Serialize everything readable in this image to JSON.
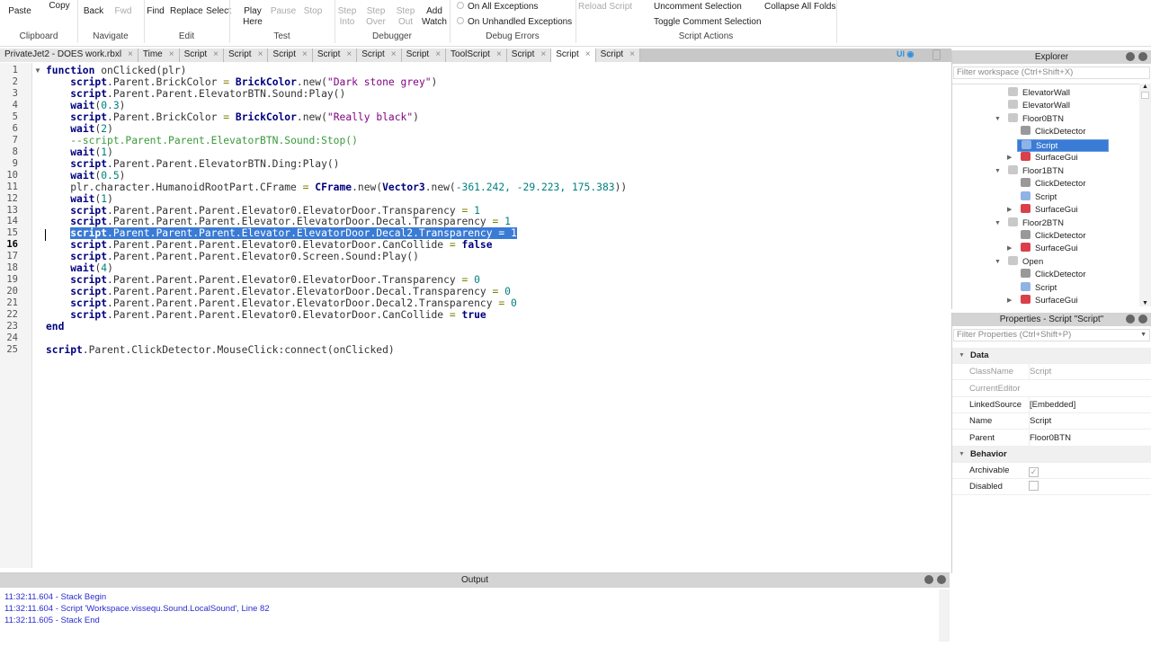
{
  "ribbon": {
    "buttons": [
      {
        "label": "Paste",
        "dis": false
      },
      {
        "label": "Copy",
        "dis": false
      },
      {
        "label": "Back",
        "dis": false
      },
      {
        "label": "Fwd",
        "dis": true
      },
      {
        "label": "Find",
        "dis": false
      },
      {
        "label": "Replace",
        "dis": false
      },
      {
        "label": "Select",
        "dis": false
      },
      {
        "label": "Play Here",
        "dis": false
      },
      {
        "label": "Pause",
        "dis": true
      },
      {
        "label": "Stop",
        "dis": true
      },
      {
        "label": "Step Into",
        "dis": true
      },
      {
        "label": "Step Over",
        "dis": true
      },
      {
        "label": "Step Out",
        "dis": true
      },
      {
        "label": "Add Watch",
        "dis": false
      }
    ],
    "groups": [
      "Clipboard",
      "Navigate",
      "Edit",
      "Test",
      "Debugger",
      "Debug Errors",
      "Script Actions"
    ],
    "debug_errors": [
      "On All Exceptions",
      "On Unhandled Exceptions"
    ],
    "reload_script": "Reload Script",
    "uncomment": "Uncomment Selection",
    "toggle_comment": "Toggle Comment Selection",
    "collapse_folds": "Collapse All Folds"
  },
  "tabs": [
    {
      "label": "PrivateJet2 - DOES work.rbxl"
    },
    {
      "label": "Time"
    },
    {
      "label": "Script"
    },
    {
      "label": "Script"
    },
    {
      "label": "Script"
    },
    {
      "label": "Script"
    },
    {
      "label": "Script"
    },
    {
      "label": "Script"
    },
    {
      "label": "ToolScript"
    },
    {
      "label": "Script"
    },
    {
      "label": "Script",
      "active": true
    },
    {
      "label": "Script"
    }
  ],
  "ui_toggle": "UI",
  "code": {
    "selected_line": 15,
    "current_line": 16,
    "lines": [
      [
        {
          "c": "kw",
          "t": "function"
        },
        {
          "c": "",
          "t": " onClicked(plr)"
        }
      ],
      [
        {
          "c": "",
          "t": "    "
        },
        {
          "c": "kw",
          "t": "script"
        },
        {
          "c": "",
          "t": ".Parent.BrickColor "
        },
        {
          "c": "op",
          "t": "="
        },
        {
          "c": "",
          "t": " "
        },
        {
          "c": "bi",
          "t": "BrickColor"
        },
        {
          "c": "",
          "t": ".new("
        },
        {
          "c": "st",
          "t": "\"Dark stone grey\""
        },
        {
          "c": "",
          "t": ")"
        }
      ],
      [
        {
          "c": "",
          "t": "    "
        },
        {
          "c": "kw",
          "t": "script"
        },
        {
          "c": "",
          "t": ".Parent.Parent.ElevatorBTN.Sound:Play()"
        }
      ],
      [
        {
          "c": "",
          "t": "    "
        },
        {
          "c": "kw",
          "t": "wait"
        },
        {
          "c": "",
          "t": "("
        },
        {
          "c": "nu",
          "t": "0.3"
        },
        {
          "c": "",
          "t": ")"
        }
      ],
      [
        {
          "c": "",
          "t": "    "
        },
        {
          "c": "kw",
          "t": "script"
        },
        {
          "c": "",
          "t": ".Parent.BrickColor "
        },
        {
          "c": "op",
          "t": "="
        },
        {
          "c": "",
          "t": " "
        },
        {
          "c": "bi",
          "t": "BrickColor"
        },
        {
          "c": "",
          "t": ".new("
        },
        {
          "c": "st",
          "t": "\"Really black\""
        },
        {
          "c": "",
          "t": ")"
        }
      ],
      [
        {
          "c": "",
          "t": "    "
        },
        {
          "c": "kw",
          "t": "wait"
        },
        {
          "c": "",
          "t": "("
        },
        {
          "c": "nu",
          "t": "2"
        },
        {
          "c": "",
          "t": ")"
        }
      ],
      [
        {
          "c": "",
          "t": "    "
        },
        {
          "c": "cm",
          "t": "--script.Parent.Parent.ElevatorBTN.Sound:Stop()"
        }
      ],
      [
        {
          "c": "",
          "t": "    "
        },
        {
          "c": "kw",
          "t": "wait"
        },
        {
          "c": "",
          "t": "("
        },
        {
          "c": "nu",
          "t": "1"
        },
        {
          "c": "",
          "t": ")"
        }
      ],
      [
        {
          "c": "",
          "t": "    "
        },
        {
          "c": "kw",
          "t": "script"
        },
        {
          "c": "",
          "t": ".Parent.Parent.ElevatorBTN.Ding:Play()"
        }
      ],
      [
        {
          "c": "",
          "t": "    "
        },
        {
          "c": "kw",
          "t": "wait"
        },
        {
          "c": "",
          "t": "("
        },
        {
          "c": "nu",
          "t": "0.5"
        },
        {
          "c": "",
          "t": ")"
        }
      ],
      [
        {
          "c": "",
          "t": "    plr.character.HumanoidRootPart.CFrame "
        },
        {
          "c": "op",
          "t": "="
        },
        {
          "c": "",
          "t": " "
        },
        {
          "c": "bi",
          "t": "CFrame"
        },
        {
          "c": "",
          "t": ".new("
        },
        {
          "c": "bi",
          "t": "Vector3"
        },
        {
          "c": "",
          "t": ".new("
        },
        {
          "c": "nu",
          "t": "-361.242, -29.223, 175.383"
        },
        {
          "c": "",
          "t": "))"
        }
      ],
      [
        {
          "c": "",
          "t": "    "
        },
        {
          "c": "kw",
          "t": "wait"
        },
        {
          "c": "",
          "t": "("
        },
        {
          "c": "nu",
          "t": "1"
        },
        {
          "c": "",
          "t": ")"
        }
      ],
      [
        {
          "c": "",
          "t": "    "
        },
        {
          "c": "kw",
          "t": "script"
        },
        {
          "c": "",
          "t": ".Parent.Parent.Parent.Elevator0.ElevatorDoor.Transparency "
        },
        {
          "c": "op",
          "t": "="
        },
        {
          "c": "nu",
          "t": " 1"
        }
      ],
      [
        {
          "c": "",
          "t": "    "
        },
        {
          "c": "kw",
          "t": "script"
        },
        {
          "c": "",
          "t": ".Parent.Parent.Parent.Elevator.ElevatorDoor.Decal.Transparency "
        },
        {
          "c": "op",
          "t": "="
        },
        {
          "c": "nu",
          "t": " 1"
        }
      ],
      [
        {
          "c": "",
          "t": "    "
        },
        {
          "c": "kw",
          "t": "script"
        },
        {
          "c": "",
          "t": ".Parent.Parent.Parent.Elevator.ElevatorDoor.Decal2.Transparency "
        },
        {
          "c": "op",
          "t": "="
        },
        {
          "c": "nu",
          "t": " 1"
        }
      ],
      [
        {
          "c": "",
          "t": "    "
        },
        {
          "c": "kw",
          "t": "script"
        },
        {
          "c": "",
          "t": ".Parent.Parent.Parent.Elevator0.ElevatorDoor.CanCollide "
        },
        {
          "c": "op",
          "t": "="
        },
        {
          "c": "",
          "t": " "
        },
        {
          "c": "kw",
          "t": "false"
        }
      ],
      [
        {
          "c": "",
          "t": "    "
        },
        {
          "c": "kw",
          "t": "script"
        },
        {
          "c": "",
          "t": ".Parent.Parent.Parent.Elevator0.Screen.Sound:Play()"
        }
      ],
      [
        {
          "c": "",
          "t": "    "
        },
        {
          "c": "kw",
          "t": "wait"
        },
        {
          "c": "",
          "t": "("
        },
        {
          "c": "nu",
          "t": "4"
        },
        {
          "c": "",
          "t": ")"
        }
      ],
      [
        {
          "c": "",
          "t": "    "
        },
        {
          "c": "kw",
          "t": "script"
        },
        {
          "c": "",
          "t": ".Parent.Parent.Parent.Elevator0.ElevatorDoor.Transparency "
        },
        {
          "c": "op",
          "t": "="
        },
        {
          "c": "nu",
          "t": " 0"
        }
      ],
      [
        {
          "c": "",
          "t": "    "
        },
        {
          "c": "kw",
          "t": "script"
        },
        {
          "c": "",
          "t": ".Parent.Parent.Parent.Elevator.ElevatorDoor.Decal.Transparency "
        },
        {
          "c": "op",
          "t": "="
        },
        {
          "c": "nu",
          "t": " 0"
        }
      ],
      [
        {
          "c": "",
          "t": "    "
        },
        {
          "c": "kw",
          "t": "script"
        },
        {
          "c": "",
          "t": ".Parent.Parent.Parent.Elevator.ElevatorDoor.Decal2.Transparency "
        },
        {
          "c": "op",
          "t": "="
        },
        {
          "c": "nu",
          "t": " 0"
        }
      ],
      [
        {
          "c": "",
          "t": "    "
        },
        {
          "c": "kw",
          "t": "script"
        },
        {
          "c": "",
          "t": ".Parent.Parent.Parent.Elevator0.ElevatorDoor.CanCollide "
        },
        {
          "c": "op",
          "t": "="
        },
        {
          "c": "",
          "t": " "
        },
        {
          "c": "kw",
          "t": "true"
        }
      ],
      [
        {
          "c": "kw",
          "t": "end"
        }
      ],
      [],
      [
        {
          "c": "kw",
          "t": "script"
        },
        {
          "c": "",
          "t": ".Parent.ClickDetector.MouseClick:connect(onClicked)"
        }
      ]
    ]
  },
  "explorer": {
    "title": "Explorer",
    "filter_placeholder": "Filter workspace (Ctrl+Shift+X)",
    "items": [
      {
        "label": "ElevatorWall",
        "depth": 0,
        "icon": "part-icon",
        "exp": ""
      },
      {
        "label": "ElevatorWall",
        "depth": 0,
        "icon": "part-icon",
        "exp": ""
      },
      {
        "label": "Floor0BTN",
        "depth": 0,
        "icon": "part-icon",
        "exp": "open"
      },
      {
        "label": "ClickDetector",
        "depth": 1,
        "icon": "click-detector-icon",
        "exp": ""
      },
      {
        "label": "Script",
        "depth": 1,
        "icon": "script-icon",
        "exp": "",
        "selected": true
      },
      {
        "label": "SurfaceGui",
        "depth": 1,
        "icon": "surface-gui-icon",
        "exp": "closed"
      },
      {
        "label": "Floor1BTN",
        "depth": 0,
        "icon": "part-icon",
        "exp": "open"
      },
      {
        "label": "ClickDetector",
        "depth": 1,
        "icon": "click-detector-icon",
        "exp": ""
      },
      {
        "label": "Script",
        "depth": 1,
        "icon": "script-icon",
        "exp": ""
      },
      {
        "label": "SurfaceGui",
        "depth": 1,
        "icon": "surface-gui-icon",
        "exp": "closed"
      },
      {
        "label": "Floor2BTN",
        "depth": 0,
        "icon": "part-icon",
        "exp": "open"
      },
      {
        "label": "ClickDetector",
        "depth": 1,
        "icon": "click-detector-icon",
        "exp": ""
      },
      {
        "label": "SurfaceGui",
        "depth": 1,
        "icon": "surface-gui-icon",
        "exp": "closed"
      },
      {
        "label": "Open",
        "depth": 0,
        "icon": "part-icon",
        "exp": "open"
      },
      {
        "label": "ClickDetector",
        "depth": 1,
        "icon": "click-detector-icon",
        "exp": ""
      },
      {
        "label": "Script",
        "depth": 1,
        "icon": "script-icon",
        "exp": ""
      },
      {
        "label": "SurfaceGui",
        "depth": 1,
        "icon": "surface-gui-icon",
        "exp": "closed"
      }
    ]
  },
  "properties": {
    "title": "Properties - Script \"Script\"",
    "filter_placeholder": "Filter Properties (Ctrl+Shift+P)",
    "sections": [
      {
        "name": "Data",
        "rows": [
          {
            "key": "ClassName",
            "value": "Script",
            "dim": true
          },
          {
            "key": "CurrentEditor",
            "value": "",
            "dim": true
          },
          {
            "key": "LinkedSource",
            "value": "[Embedded]"
          },
          {
            "key": "Name",
            "value": "Script"
          },
          {
            "key": "Parent",
            "value": "Floor0BTN"
          }
        ]
      },
      {
        "name": "Behavior",
        "rows": [
          {
            "key": "Archivable",
            "check": true
          },
          {
            "key": "Disabled",
            "check": false
          }
        ]
      }
    ]
  },
  "output": {
    "title": "Output",
    "lines": [
      "11:32:11.604 - Stack Begin",
      "11:32:11.604 - Script 'Workspace.vissequ.Sound.LocalSound', Line 82",
      "11:32:11.605 - Stack End"
    ],
    "text_color": "#2b2bd0"
  },
  "colors": {
    "selection": "#3a7bd5",
    "accent": "#2f8fe0"
  }
}
